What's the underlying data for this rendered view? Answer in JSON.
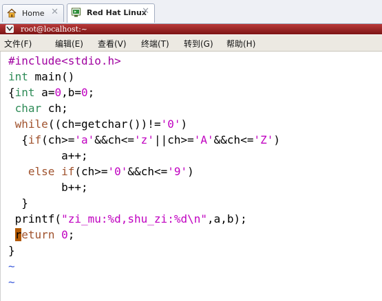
{
  "tabs": [
    {
      "label": "Home",
      "icon": "home-icon",
      "close": "✕"
    },
    {
      "label": "Red Hat Linux",
      "icon": "terminal-vm-icon",
      "close": "✕"
    }
  ],
  "window": {
    "title": "root@localhost:~"
  },
  "menu": [
    "文件(F)",
    "编辑(E)",
    "查看(V)",
    "终端(T)",
    "转到(G)",
    "帮助(H)"
  ],
  "code_lines": [
    [
      {
        "t": "#include<stdio.h>",
        "c": "#a000a0"
      }
    ],
    [
      {
        "t": "int",
        "c": "#2e8b57"
      },
      {
        "t": " main()",
        "c": "#000000"
      }
    ],
    [
      {
        "t": "{",
        "c": "#000000"
      },
      {
        "t": "int",
        "c": "#2e8b57"
      },
      {
        "t": " a=",
        "c": "#000000"
      },
      {
        "t": "0",
        "c": "#c000c0"
      },
      {
        "t": ",b=",
        "c": "#000000"
      },
      {
        "t": "0",
        "c": "#c000c0"
      },
      {
        "t": ";",
        "c": "#000000"
      }
    ],
    [
      {
        "t": " ",
        "c": "#000000"
      },
      {
        "t": "char",
        "c": "#2e8b57"
      },
      {
        "t": " ch;",
        "c": "#000000"
      }
    ],
    [
      {
        "t": " ",
        "c": "#000000"
      },
      {
        "t": "while",
        "c": "#a0522d"
      },
      {
        "t": "((ch=getchar())!=",
        "c": "#000000"
      },
      {
        "t": "'0'",
        "c": "#c000c0"
      },
      {
        "t": ")",
        "c": "#000000"
      }
    ],
    [
      {
        "t": "  {",
        "c": "#000000"
      },
      {
        "t": "if",
        "c": "#a0522d"
      },
      {
        "t": "(ch>=",
        "c": "#000000"
      },
      {
        "t": "'a'",
        "c": "#c000c0"
      },
      {
        "t": "&&ch<=",
        "c": "#000000"
      },
      {
        "t": "'z'",
        "c": "#c000c0"
      },
      {
        "t": "||ch>=",
        "c": "#000000"
      },
      {
        "t": "'A'",
        "c": "#c000c0"
      },
      {
        "t": "&&ch<=",
        "c": "#000000"
      },
      {
        "t": "'Z'",
        "c": "#c000c0"
      },
      {
        "t": ")",
        "c": "#000000"
      }
    ],
    [
      {
        "t": "        a++;",
        "c": "#000000"
      }
    ],
    [
      {
        "t": "   ",
        "c": "#000000"
      },
      {
        "t": "else",
        "c": "#a0522d"
      },
      {
        "t": " ",
        "c": "#000000"
      },
      {
        "t": "if",
        "c": "#a0522d"
      },
      {
        "t": "(ch>=",
        "c": "#000000"
      },
      {
        "t": "'0'",
        "c": "#c000c0"
      },
      {
        "t": "&&ch<=",
        "c": "#000000"
      },
      {
        "t": "'9'",
        "c": "#c000c0"
      },
      {
        "t": ")",
        "c": "#000000"
      }
    ],
    [
      {
        "t": "        b++;",
        "c": "#000000"
      }
    ],
    [
      {
        "t": "  }",
        "c": "#000000"
      }
    ],
    [
      {
        "t": " printf(",
        "c": "#000000"
      },
      {
        "t": "\"zi_mu:%d,shu_zi:%d\\n\"",
        "c": "#c000c0"
      },
      {
        "t": ",a,b);",
        "c": "#000000"
      }
    ],
    [
      {
        "t": " ",
        "c": "#000000"
      },
      {
        "t": "r",
        "c": "#000000",
        "cursor": true
      },
      {
        "t": "eturn",
        "c": "#a0522d"
      },
      {
        "t": " ",
        "c": "#000000"
      },
      {
        "t": "0",
        "c": "#c000c0"
      },
      {
        "t": ";",
        "c": "#000000"
      }
    ],
    [
      {
        "t": "}",
        "c": "#000000"
      }
    ],
    [
      {
        "t": "~",
        "c": "#3b5bdb"
      }
    ],
    [
      {
        "t": "~",
        "c": "#3b5bdb"
      }
    ]
  ],
  "colors": {
    "titlebar": "#9b2222",
    "cursor": "#b35900",
    "tilde": "#3b5bdb"
  }
}
